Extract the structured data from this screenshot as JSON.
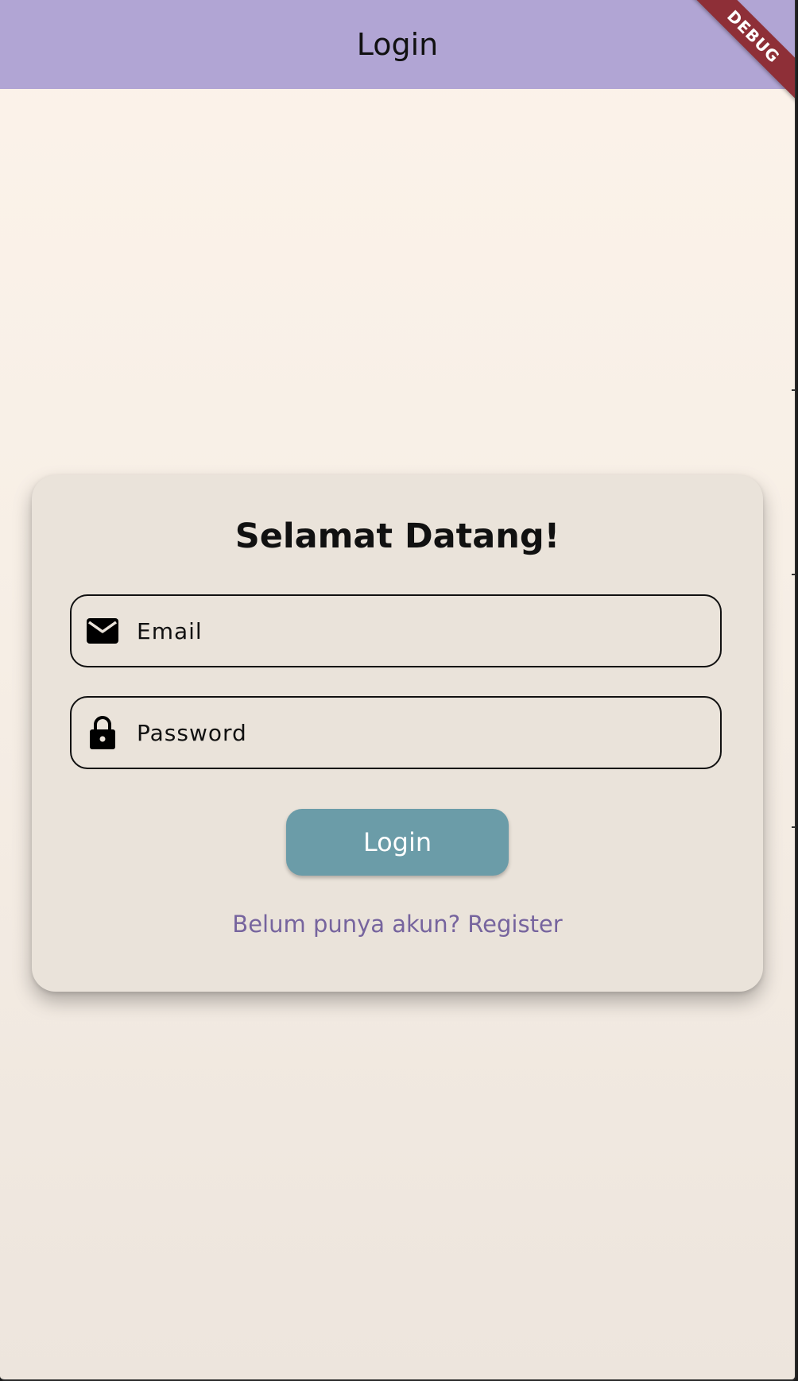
{
  "appbar": {
    "title": "Login",
    "debug_banner": "DEBUG"
  },
  "card": {
    "title": "Selamat Datang!",
    "email": {
      "placeholder": "Email",
      "value": "",
      "icon": "mail-icon"
    },
    "password": {
      "placeholder": "Password",
      "value": "",
      "icon": "lock-icon"
    },
    "login_button": "Login",
    "register_link": "Belum punya akun? Register"
  },
  "colors": {
    "appbar": "#b1a5d4",
    "background": "#fcf3ea",
    "card": "#eae3da",
    "button": "#6b9ca8",
    "link": "#76649e",
    "debug": "#8e2f37"
  }
}
